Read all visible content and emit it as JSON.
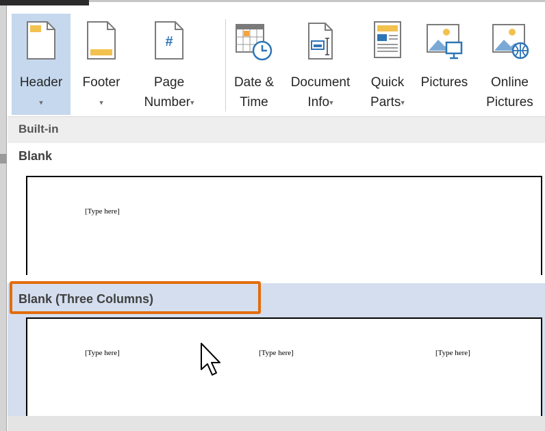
{
  "ribbon": {
    "buttons": [
      {
        "id": "header",
        "line1": "Header",
        "line2": "",
        "caret": "▾",
        "active": true
      },
      {
        "id": "footer",
        "line1": "Footer",
        "line2": "",
        "caret": "▾"
      },
      {
        "id": "page-number",
        "line1": "Page",
        "line2": "Number",
        "caret": "▾"
      },
      {
        "id": "date-time",
        "line1": "Date &",
        "line2": "Time",
        "caret": ""
      },
      {
        "id": "document-info",
        "line1": "Document",
        "line2": "Info",
        "caret": "▾"
      },
      {
        "id": "quick-parts",
        "line1": "Quick",
        "line2": "Parts",
        "caret": "▾"
      },
      {
        "id": "pictures",
        "line1": "Pictures",
        "line2": "",
        "caret": ""
      },
      {
        "id": "online-pictures",
        "line1": "Online",
        "line2": "Pictures",
        "caret": ""
      }
    ],
    "page_number_glyph": "#"
  },
  "gallery": {
    "section_label": "Built-in",
    "items": [
      {
        "title": "Blank",
        "placeholders": [
          "[Type here]"
        ]
      },
      {
        "title": "Blank (Three Columns)",
        "placeholders": [
          "[Type here]",
          "[Type here]",
          "[Type here]"
        ]
      }
    ]
  },
  "colors": {
    "active_button": "#c5d8ee",
    "hover_row": "#d4deee",
    "highlight_box": "#e36c0a",
    "icon_blue": "#2e75b6",
    "icon_gold": "#f2c14e"
  }
}
